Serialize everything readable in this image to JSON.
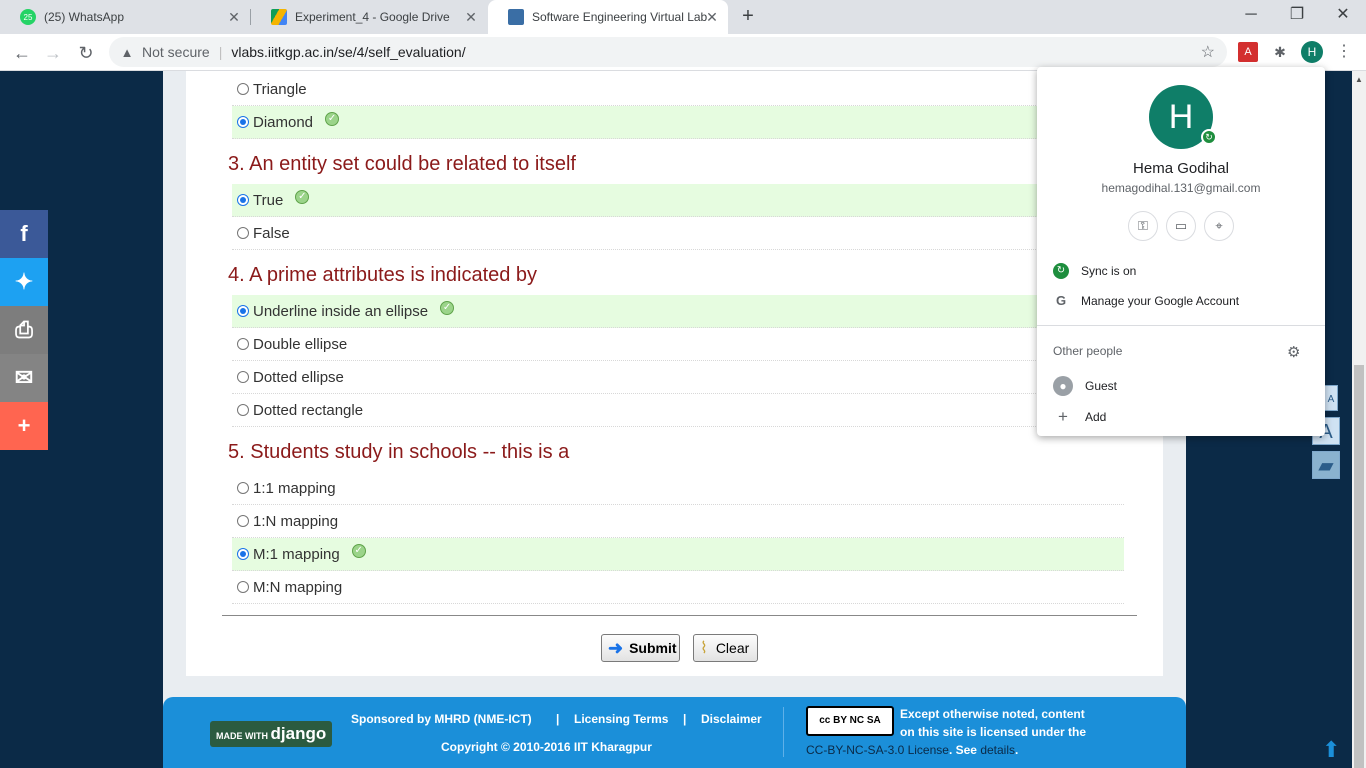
{
  "tabs": [
    {
      "title": "(25) WhatsApp",
      "badge": "25"
    },
    {
      "title": "Experiment_4 - Google Drive"
    },
    {
      "title": "Software Engineering Virtual Lab"
    }
  ],
  "toolbar": {
    "security_label": "Not secure",
    "url": "vlabs.iitkgp.ac.in/se/4/self_evaluation/",
    "profile_initial": "H"
  },
  "quiz": {
    "q2_options": [
      {
        "label": "Triangle",
        "selected": false
      },
      {
        "label": "Diamond",
        "selected": true,
        "correct": true
      }
    ],
    "q3": {
      "question": "3. An entity set could be related to itself",
      "options": [
        {
          "label": "True",
          "selected": true,
          "correct": true
        },
        {
          "label": "False",
          "selected": false
        }
      ]
    },
    "q4": {
      "question": "4. A prime attributes is indicated by",
      "options": [
        {
          "label": "Underline inside an ellipse",
          "selected": true,
          "correct": true
        },
        {
          "label": "Double ellipse",
          "selected": false
        },
        {
          "label": "Dotted ellipse",
          "selected": false
        },
        {
          "label": "Dotted rectangle",
          "selected": false
        }
      ]
    },
    "q5": {
      "question": "5. Students study in schools -- this is a",
      "options": [
        {
          "label": "1:1 mapping",
          "selected": false
        },
        {
          "label": "1:N mapping",
          "selected": false
        },
        {
          "label": "M:1 mapping",
          "selected": true,
          "correct": true
        },
        {
          "label": "M:N mapping",
          "selected": false
        }
      ]
    },
    "submit_label": "Submit",
    "clear_label": "Clear"
  },
  "footer": {
    "django_badge_prefix": "MADE WITH",
    "django_badge_name": "django",
    "sponsored": "Sponsored by MHRD (NME-ICT)",
    "separator": "|",
    "licensing": "Licensing Terms",
    "disclaimer": "Disclaimer",
    "copyright": "Copyright © 2010-2016 IIT Kharagpur",
    "cc_badge": "cc BY NC SA",
    "license_line1": "Except otherwise noted, content",
    "license_line2": "on this site is licensed under the",
    "license_link": "CC-BY-NC-SA-3.0 License",
    "license_see": ". See ",
    "details_link": "details",
    "license_end": "."
  },
  "profile_popup": {
    "initial": "H",
    "name": "Hema Godihal",
    "email": "hemagodihal.131@gmail.com",
    "sync": "Sync is on",
    "manage": "Manage your Google Account",
    "other_people": "Other people",
    "guest": "Guest",
    "add": "Add"
  },
  "colors": {
    "question": "#8b1a1a",
    "selected_row": "#e6fce0",
    "footer": "#1b8fd9",
    "page_bg": "#0b2a47",
    "avatar": "#0f7e68"
  }
}
